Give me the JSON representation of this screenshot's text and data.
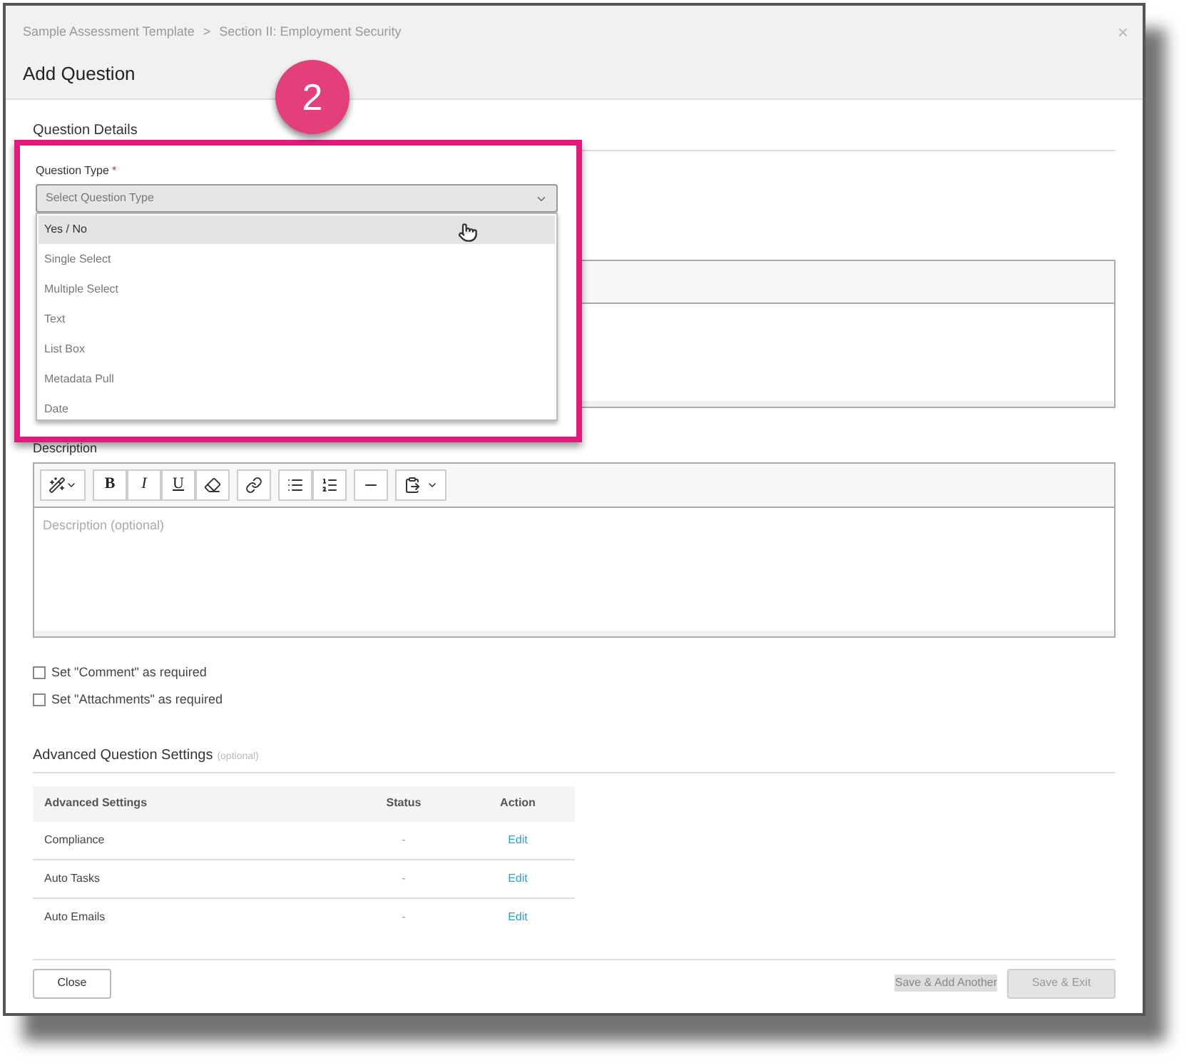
{
  "modal": {
    "breadcrumb": [
      "Sample Assessment Template",
      ">",
      "Section II: Employment Security"
    ],
    "title": "Add Question",
    "close": "×"
  },
  "step_badge": "2",
  "section": "Question Details",
  "question_type": {
    "label": "Question Type",
    "required": "*",
    "placeholder": "Select Question Type",
    "expanded": true,
    "options": [
      {
        "label": "Yes / No",
        "selected": true
      },
      {
        "label": "Single Select",
        "selected": false
      },
      {
        "label": "Multiple Select",
        "selected": false
      },
      {
        "label": "Text",
        "selected": false
      },
      {
        "label": "List Box",
        "selected": false
      },
      {
        "label": "Metadata Pull",
        "selected": false
      },
      {
        "label": "Date",
        "selected": false
      }
    ]
  },
  "description": {
    "label": "Description",
    "placeholder": "Description (optional)",
    "toolbar": [
      [
        {
          "kind": "wand"
        }
      ],
      [
        {
          "kind": "bold",
          "label": "B"
        },
        {
          "kind": "italic",
          "label": "I"
        },
        {
          "kind": "underline",
          "label": "U"
        },
        {
          "kind": "eraser"
        }
      ],
      [
        {
          "kind": "link"
        }
      ],
      [
        {
          "kind": "bullets"
        },
        {
          "kind": "numbers"
        }
      ],
      [
        {
          "kind": "rule"
        }
      ],
      [
        {
          "kind": "paste"
        }
      ]
    ]
  },
  "checkboxes": [
    {
      "label": "Set \"Comment\" as required",
      "checked": false
    },
    {
      "label": "Set \"Attachments\" as required",
      "checked": false
    }
  ],
  "advanced": {
    "title": "Advanced Question Settings",
    "note": "(optional)",
    "columns": [
      "Advanced Settings",
      "Status",
      "Action"
    ],
    "rows": [
      [
        "Compliance",
        "-",
        "Edit"
      ],
      [
        "Auto Tasks",
        "-",
        "Edit"
      ],
      [
        "Auto Emails",
        "-",
        "Edit"
      ]
    ]
  },
  "footer": {
    "close": "Close",
    "save_add": {
      "label": "Save & Add Another",
      "disabled": true
    },
    "save_exit": {
      "label": "Save & Exit",
      "disabled": true
    }
  }
}
